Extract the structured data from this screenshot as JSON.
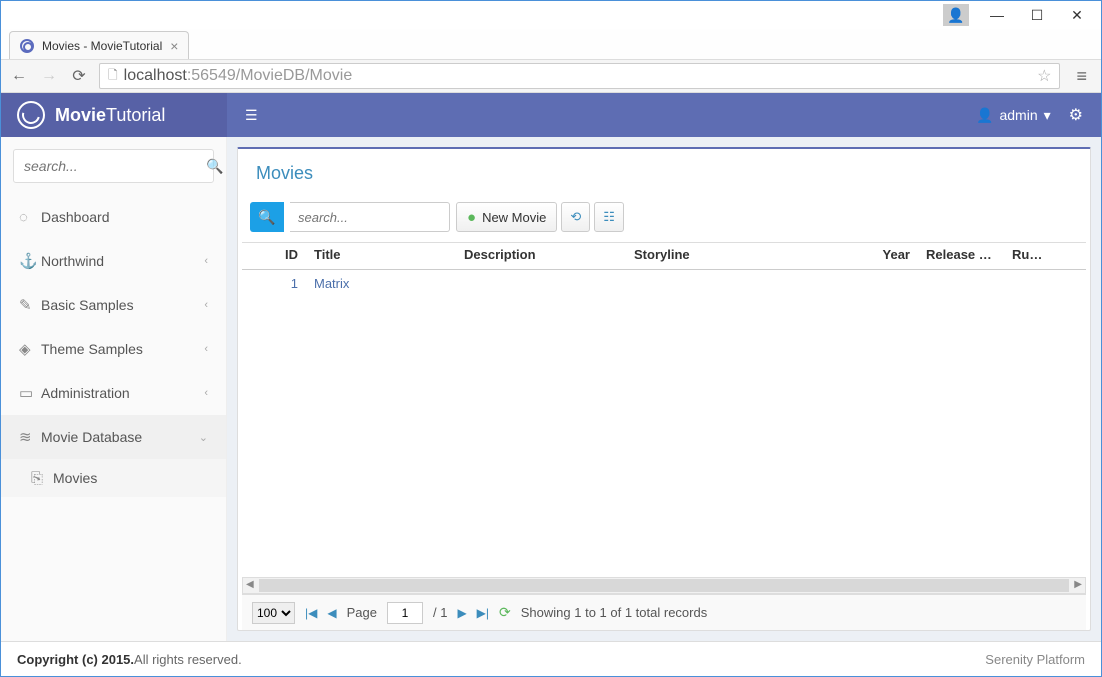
{
  "browser": {
    "tab_title": "Movies - MovieTutorial",
    "url_host": "localhost",
    "url_rest": ":56549/MovieDB/Movie"
  },
  "brand": {
    "bold": "Movie",
    "rest": "Tutorial"
  },
  "header": {
    "username": "admin"
  },
  "sidebar": {
    "search_placeholder": "search...",
    "items": [
      {
        "icon": "◌",
        "label": "Dashboard",
        "chev": ""
      },
      {
        "icon": "⚓",
        "label": "Northwind",
        "chev": "‹"
      },
      {
        "icon": "✎",
        "label": "Basic Samples",
        "chev": "‹"
      },
      {
        "icon": "◈",
        "label": "Theme Samples",
        "chev": "‹"
      },
      {
        "icon": "▭",
        "label": "Administration",
        "chev": "‹"
      },
      {
        "icon": "≋",
        "label": "Movie Database",
        "chev": "⌄"
      },
      {
        "icon": "⎘",
        "label": "Movies",
        "chev": ""
      }
    ]
  },
  "panel": {
    "title": "Movies",
    "grid_search_placeholder": "search...",
    "new_button": "New Movie"
  },
  "grid": {
    "columns": [
      "ID",
      "Title",
      "Description",
      "Storyline",
      "Year",
      "Release Da...",
      "Runtime"
    ],
    "rows": [
      {
        "id": "1",
        "title": "Matrix",
        "description": "",
        "storyline": "",
        "year": "",
        "release": "",
        "runtime": ""
      }
    ]
  },
  "pager": {
    "page_size": "100",
    "page_label": "Page",
    "page_value": "1",
    "page_total": "/ 1",
    "status": "Showing 1 to 1 of 1 total records"
  },
  "footer": {
    "copyright_bold": "Copyright (c) 2015.",
    "copyright_rest": " All rights reserved.",
    "platform": "Serenity Platform"
  }
}
